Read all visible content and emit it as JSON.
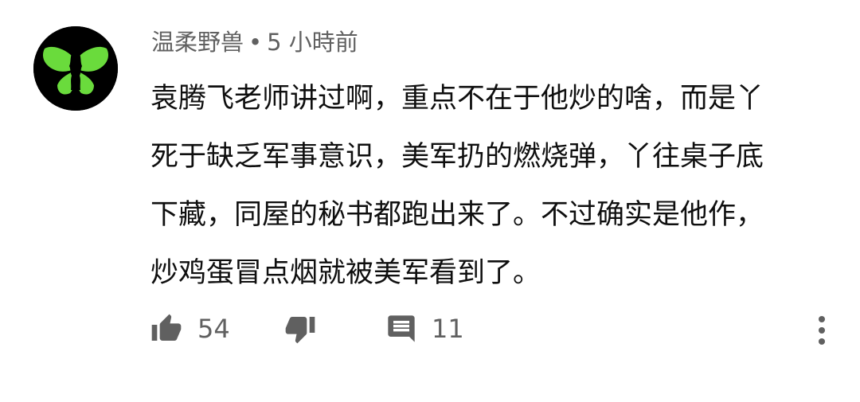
{
  "comment": {
    "author": "温柔野兽",
    "separator": "•",
    "timestamp": "5 小時前",
    "text_lines": [
      "袁腾飞老师讲过啊，重点不在于他炒的啥，而是丫",
      "死于缺乏军事意识，美军扔的燃烧弹，丫往桌子底",
      "下藏，同屋的秘书都跑出来了。不过确实是他作，",
      "炒鸡蛋冒点烟就被美军看到了。"
    ],
    "avatar": {
      "background": "#000000",
      "symbol_color": "#6adb3c",
      "icon": "green-butterfly-icon"
    },
    "actions": {
      "like_icon": "thumbs-up-icon",
      "like_count": "54",
      "dislike_icon": "thumbs-down-icon",
      "reply_icon": "reply-comment-icon",
      "reply_count": "11",
      "more_icon": "more-vertical-icon"
    }
  },
  "colors": {
    "meta_text": "#606060",
    "body_text": "#0f0f0f",
    "icon": "#606060"
  }
}
